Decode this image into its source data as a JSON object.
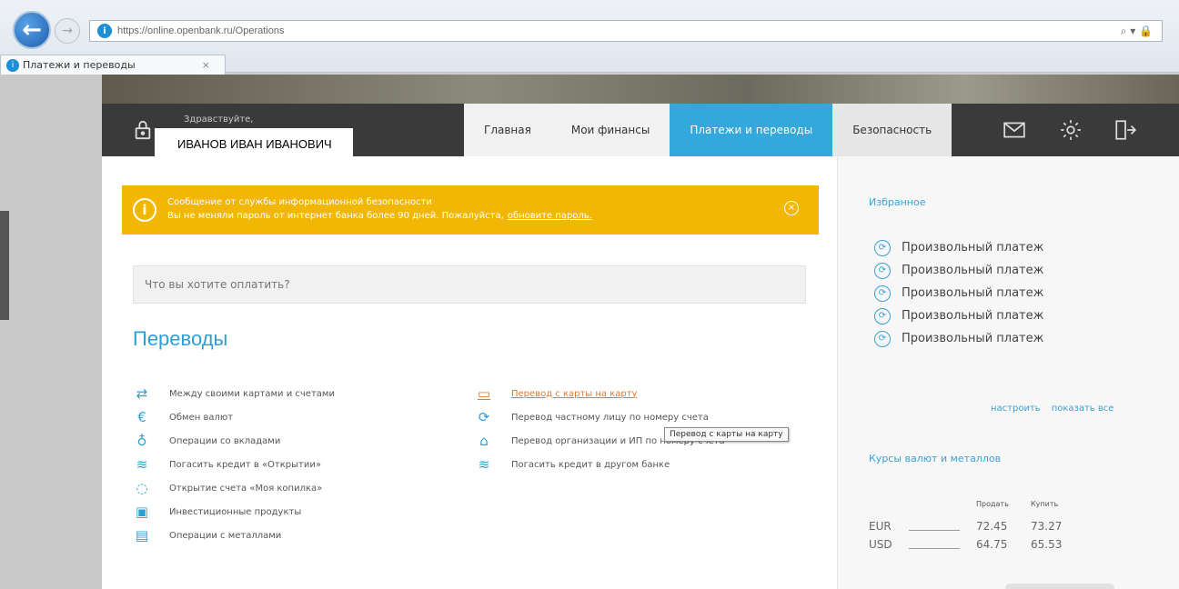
{
  "browser": {
    "url": "https://online.openbank.ru/Operations",
    "tab_title": "Платежи и переводы",
    "tab_close": "×",
    "url_right_icons": "⌕ ▾ 🔒"
  },
  "header": {
    "greeting": "Здравствуйте,",
    "user_name": "ИВАНОВ ИВАН ИВАНОВИЧ",
    "nav": [
      {
        "label": "Главная"
      },
      {
        "label": "Мои финансы"
      },
      {
        "label": "Платежи и переводы"
      },
      {
        "label": "Безопасность"
      }
    ]
  },
  "alert": {
    "line1": "Сообщение от службы информационной безопасности",
    "line2": "Вы не меняли пароль от интернет банка более 90 дней. Пожалуйста,",
    "link": "обновите пароль."
  },
  "search": {
    "placeholder": "Что вы хотите оплатить?"
  },
  "transfers": {
    "title": "Переводы",
    "col1": [
      {
        "label": "Между своими картами и счетами",
        "icon": "arrows-icon",
        "glyph": "⇄"
      },
      {
        "label": "Обмен валют",
        "icon": "currency-exchange-icon",
        "glyph": "€"
      },
      {
        "label": "Операции со вкладами",
        "icon": "deposit-icon",
        "glyph": "♁"
      },
      {
        "label": "Погасить кредит в «Открытии»",
        "icon": "credit-icon",
        "glyph": "≋"
      },
      {
        "label": "Открытие счета «Моя копилка»",
        "icon": "piggy-bank-icon",
        "glyph": "◌"
      },
      {
        "label": "Инвестиционные продукты",
        "icon": "investment-icon",
        "glyph": "▣"
      },
      {
        "label": "Операции с металлами",
        "icon": "metals-icon",
        "glyph": "▤"
      }
    ],
    "col2": [
      {
        "label": "Перевод с карты на карту",
        "icon": "card-to-card-icon",
        "glyph": "▭"
      },
      {
        "label": "Перевод частному лицу по номеру счета",
        "icon": "person-transfer-icon",
        "glyph": "⟳"
      },
      {
        "label": "Перевод организации и ИП по номеру счета",
        "icon": "organization-icon",
        "glyph": "⌂"
      },
      {
        "label": "Погасить кредит в другом банке",
        "icon": "other-bank-credit-icon",
        "glyph": "≋"
      }
    ],
    "tooltip": "Перевод с карты на карту"
  },
  "favorites": {
    "title": "Избранное",
    "items": [
      {
        "label": "Произвольный платеж"
      },
      {
        "label": "Произвольный платеж"
      },
      {
        "label": "Произвольный платеж"
      },
      {
        "label": "Произвольный платеж"
      },
      {
        "label": "Произвольный платеж"
      }
    ],
    "configure": "настроить",
    "show_all": "показать все"
  },
  "rates": {
    "title": "Курсы валют и металлов",
    "sell_header": "Продать",
    "buy_header": "Купить",
    "rows": [
      {
        "code": "EUR",
        "sell": "72.45",
        "buy": "73.27"
      },
      {
        "code": "USD",
        "sell": "64.75",
        "buy": "65.53"
      }
    ]
  }
}
